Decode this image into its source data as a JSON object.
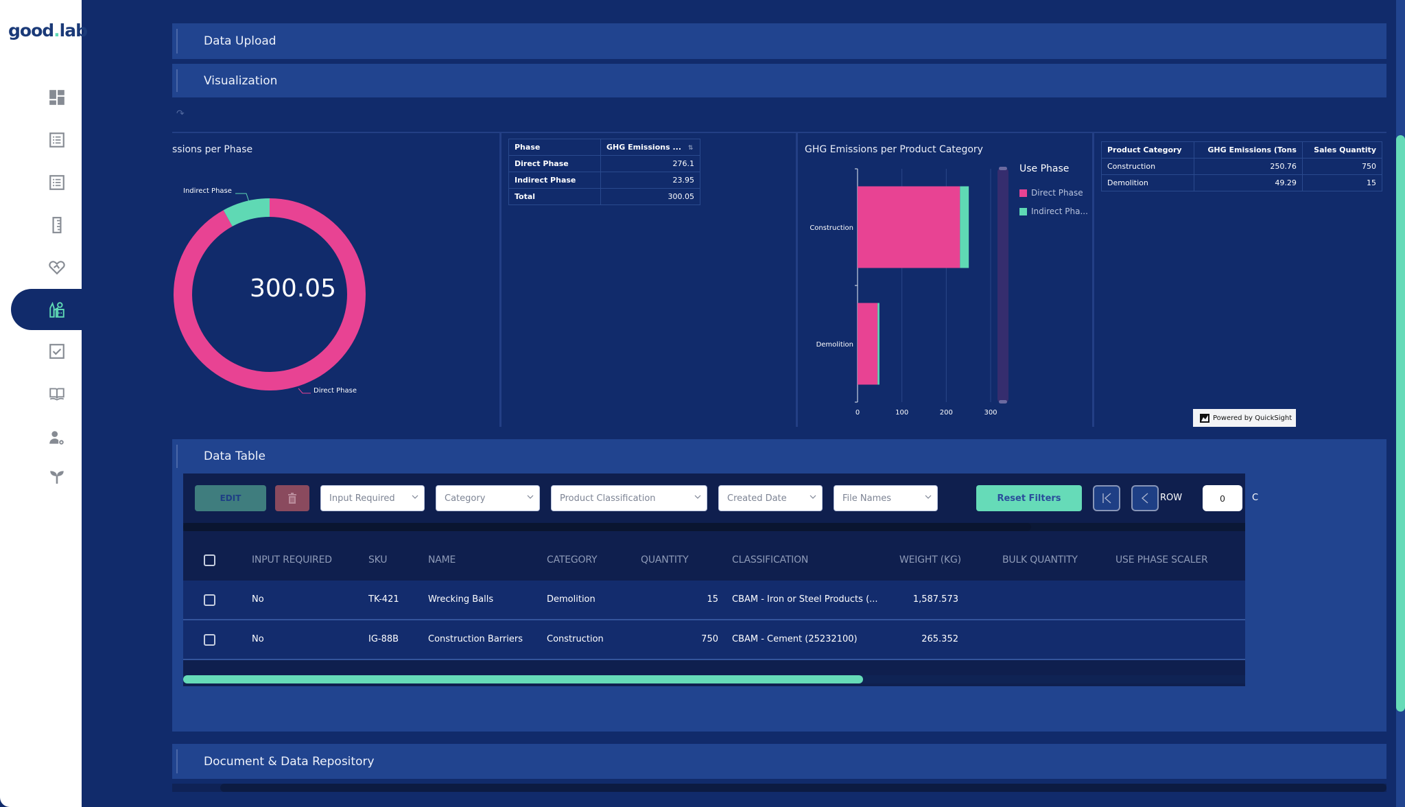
{
  "app": {
    "logo_text": "good",
    "logo_dot": ".",
    "logo_suffix": "lab"
  },
  "sidebar": {
    "items": [
      {
        "name": "dashboard",
        "icon": "dashboard-icon",
        "active": false
      },
      {
        "name": "list-a",
        "icon": "list-icon",
        "active": false
      },
      {
        "name": "list-b",
        "icon": "list-icon",
        "active": false
      },
      {
        "name": "ruler",
        "icon": "ruler-icon",
        "active": false
      },
      {
        "name": "handshake",
        "icon": "handshake-heart-icon",
        "active": false
      },
      {
        "name": "factory",
        "icon": "factory-emissions-icon",
        "active": true
      },
      {
        "name": "checklist",
        "icon": "checkbox-icon",
        "active": false
      },
      {
        "name": "library",
        "icon": "book-icon",
        "active": false
      },
      {
        "name": "user-settings",
        "icon": "user-gear-icon",
        "active": false
      },
      {
        "name": "sustainability",
        "icon": "sprout-icon",
        "active": false
      }
    ]
  },
  "sections": {
    "data_upload": "Data Upload",
    "visualization": "Visualization",
    "data_table": "Data Table",
    "repository": "Document & Data Repository"
  },
  "viz": {
    "donut": {
      "title": "ssions per Phase",
      "center_value": "300.05",
      "label_indirect": "Indirect Phase",
      "label_direct": "Direct Phase"
    },
    "phase_table": {
      "headers": [
        "Phase",
        "GHG Emissions ..."
      ],
      "rows": [
        [
          "Direct Phase",
          "276.1"
        ],
        [
          "Indirect Phase",
          "23.95"
        ],
        [
          "Total",
          "300.05"
        ]
      ]
    },
    "bar": {
      "title": "GHG Emissions per Product Category",
      "legend_title": "Use Phase",
      "legend": [
        "Direct Phase",
        "Indirect Pha..."
      ]
    },
    "category_table": {
      "headers": [
        "Product Category",
        "GHG Emissions (Tons",
        "Sales Quantity"
      ],
      "rows": [
        [
          "Construction",
          "250.76",
          "750"
        ],
        [
          "Demolition",
          "49.29",
          "15"
        ]
      ]
    },
    "powered_by": "Powered by QuickSight"
  },
  "chart_data": [
    {
      "type": "pie",
      "title": "GHG Emissions per Phase",
      "categories": [
        "Direct Phase",
        "Indirect Phase"
      ],
      "values": [
        276.1,
        23.95
      ],
      "center_label": "300.05",
      "colors": [
        "#e84393",
        "#5fd9b4"
      ]
    },
    {
      "type": "bar",
      "orientation": "horizontal",
      "stacked": true,
      "title": "GHG Emissions per Product Category",
      "categories": [
        "Construction",
        "Demolition"
      ],
      "series": [
        {
          "name": "Direct Phase",
          "values": [
            230.9,
            45.2
          ],
          "color": "#e84393"
        },
        {
          "name": "Indirect Phase",
          "values": [
            19.86,
            4.09
          ],
          "color": "#5fd9b4"
        }
      ],
      "xlim": [
        0,
        300
      ],
      "xticks": [
        "0",
        "100",
        "200",
        "300"
      ],
      "legend_title": "Use Phase",
      "legend_position": "right",
      "grid": true
    }
  ],
  "data_table": {
    "toolbar": {
      "edit_label": "EDIT",
      "delete_icon": "trash-icon",
      "filters": [
        "Input Required",
        "Category",
        "Product Classification",
        "Created Date",
        "File Names"
      ],
      "reset_label": "Reset Filters",
      "row_label": "ROW",
      "row_value": "0",
      "row_of": "C"
    },
    "columns": [
      "INPUT REQUIRED",
      "SKU",
      "NAME",
      "CATEGORY",
      "QUANTITY",
      "CLASSIFICATION",
      "WEIGHT (KG)",
      "BULK QUANTITY",
      "USE PHASE SCALER"
    ],
    "rows": [
      {
        "input_required": "No",
        "sku": "TK-421",
        "name": "Wrecking Balls",
        "category": "Demolition",
        "quantity": "15",
        "classification": "CBAM - Iron or Steel Products (...",
        "weight": "1,587.573",
        "bulk_quantity": "",
        "use_phase_scaler": ""
      },
      {
        "input_required": "No",
        "sku": "IG-88B",
        "name": "Construction Barriers",
        "category": "Construction",
        "quantity": "750",
        "classification": "CBAM - Cement (25232100)",
        "weight": "265.352",
        "bulk_quantity": "",
        "use_phase_scaler": ""
      }
    ],
    "horizontal_scroll_fraction": 0.64
  },
  "colors": {
    "background": "#112b6b",
    "section": "#21448f",
    "accent_green": "#66dbb8",
    "accent_pink": "#e84393"
  }
}
